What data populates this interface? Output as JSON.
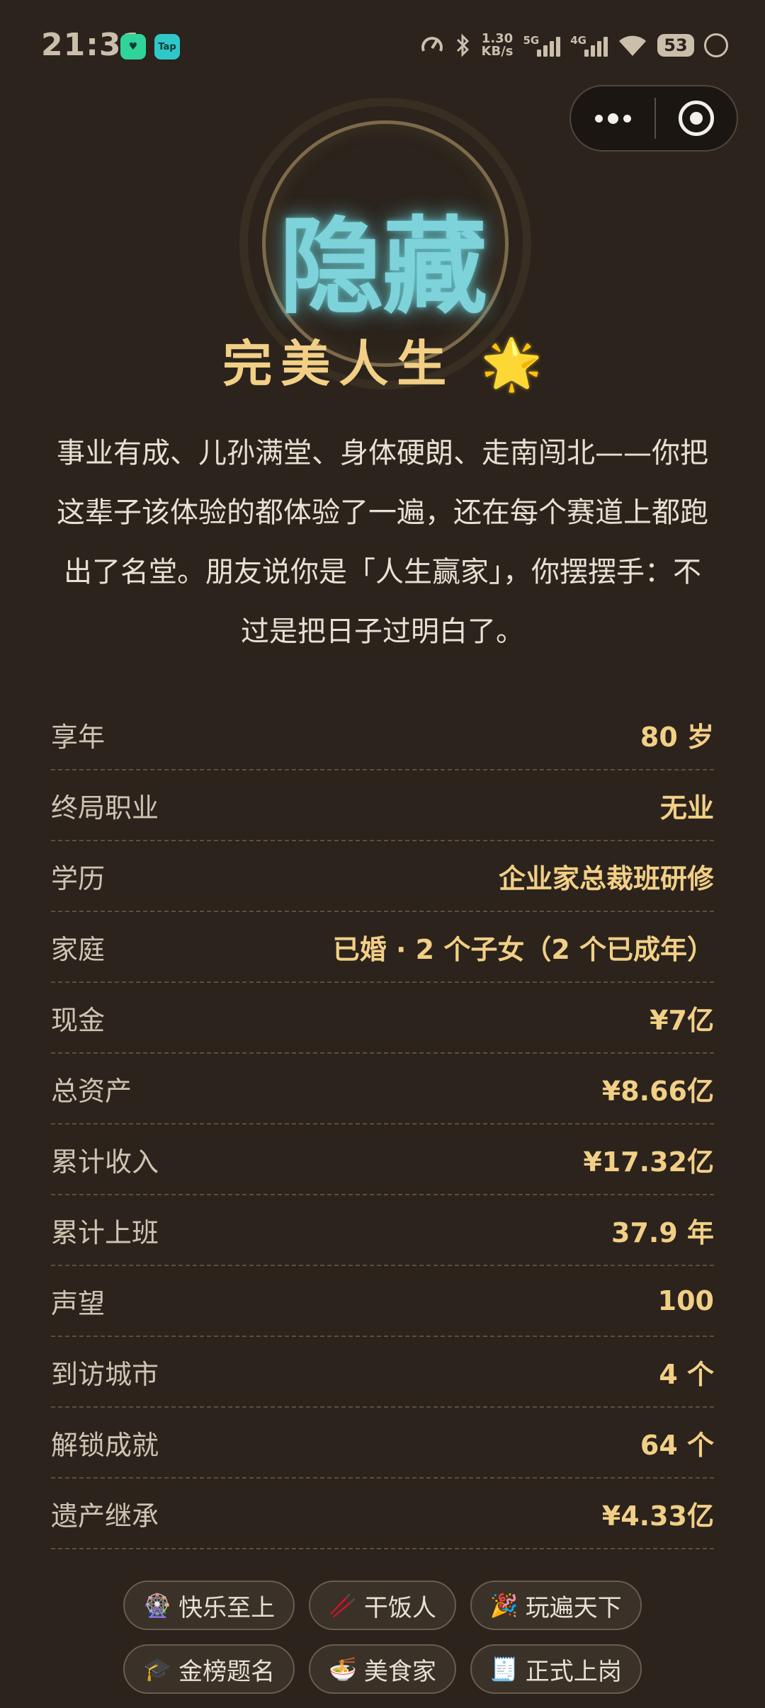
{
  "status_bar": {
    "time": "21:31",
    "app_badge_1": "♥",
    "app_badge_2": "Tap",
    "net_speed_value": "1.30",
    "net_speed_unit": "KB/s",
    "sig1_label": "5G",
    "sig2_label": "4G",
    "battery": "53",
    "icons": [
      "speedometer-icon",
      "bluetooth-icon",
      "signal-icon",
      "wifi-icon",
      "battery-icon",
      "round-status-icon"
    ]
  },
  "header": {
    "seal_text": "隐藏",
    "subtitle": "完美人生",
    "subtitle_emoji": "🌟"
  },
  "description": "事业有成、儿孙满堂、身体硬朗、走南闯北——你把这辈子该体验的都体验了一遍，还在每个赛道上都跑出了名堂。朋友说你是「人生赢家」，你摆摆手：不过是把日子过明白了。",
  "stats": [
    {
      "label": "享年",
      "value": "80 岁"
    },
    {
      "label": "终局职业",
      "value": "无业"
    },
    {
      "label": "学历",
      "value": "企业家总裁班研修"
    },
    {
      "label": "家庭",
      "value": "已婚 · 2 个子女（2 个已成年）"
    },
    {
      "label": "现金",
      "value": "¥7亿"
    },
    {
      "label": "总资产",
      "value": "¥8.66亿"
    },
    {
      "label": "累计收入",
      "value": "¥17.32亿"
    },
    {
      "label": "累计上班",
      "value": "37.9 年"
    },
    {
      "label": "声望",
      "value": "100"
    },
    {
      "label": "到访城市",
      "value": "4 个"
    },
    {
      "label": "解锁成就",
      "value": "64 个"
    },
    {
      "label": "遗产继承",
      "value": "¥4.33亿"
    }
  ],
  "tags": [
    {
      "emoji": "🎡",
      "label": "快乐至上"
    },
    {
      "emoji": "🥢",
      "label": "干饭人"
    },
    {
      "emoji": "🎉",
      "label": "玩遍天下"
    },
    {
      "emoji": "🎓",
      "label": "金榜题名"
    },
    {
      "emoji": "🍜",
      "label": "美食家"
    },
    {
      "emoji": "🧾",
      "label": "正式上岗"
    }
  ],
  "colors": {
    "background": "#2b231c",
    "seal_glow": "#7ed3db",
    "gold": "#f2cf86"
  }
}
